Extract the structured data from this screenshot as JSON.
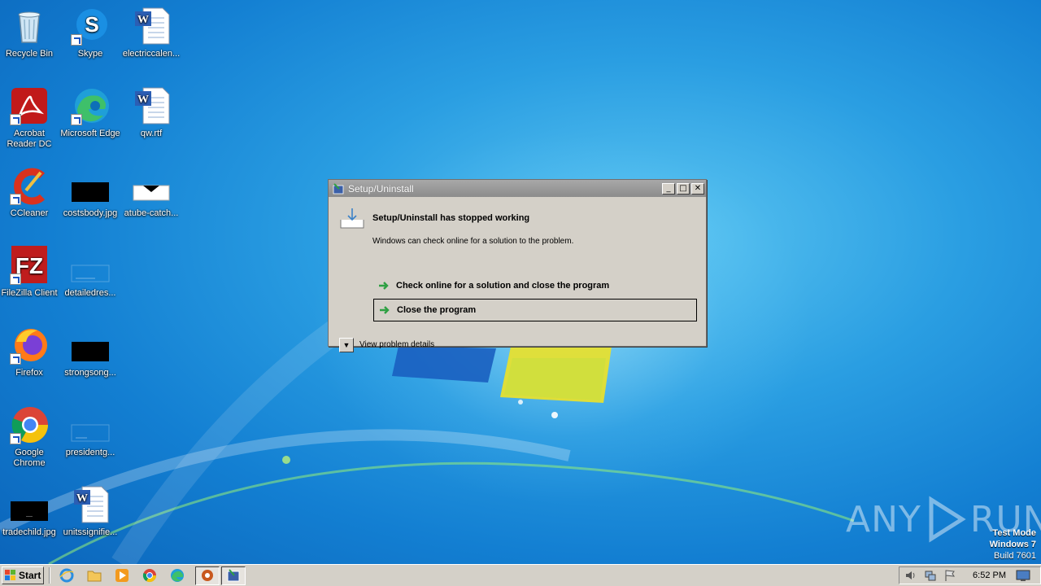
{
  "desktop": {
    "icons": [
      {
        "label": "Recycle Bin",
        "icon": "recycle-bin-icon"
      },
      {
        "label": "Skype",
        "icon": "skype-icon"
      },
      {
        "label": "electriccalen...",
        "icon": "word-document-icon"
      },
      {
        "label": "Acrobat Reader DC",
        "icon": "acrobat-icon"
      },
      {
        "label": "Microsoft Edge",
        "icon": "edge-icon"
      },
      {
        "label": "qw.rtf",
        "icon": "word-document-icon"
      },
      {
        "label": "CCleaner",
        "icon": "ccleaner-icon"
      },
      {
        "label": "costsbody.jpg",
        "icon": "image-file-icon"
      },
      {
        "label": "atube-catch...",
        "icon": "image-file-icon"
      },
      {
        "label": "FileZilla Client",
        "icon": "filezilla-icon"
      },
      {
        "label": "detailedres...",
        "icon": "image-file-icon"
      },
      {
        "label": "Firefox",
        "icon": "firefox-icon"
      },
      {
        "label": "strongsong...",
        "icon": "image-file-icon"
      },
      {
        "label": "Google Chrome",
        "icon": "chrome-icon"
      },
      {
        "label": "presidentg...",
        "icon": "image-file-icon"
      },
      {
        "label": "tradechild.jpg",
        "icon": "image-file-icon"
      },
      {
        "label": "unitssignifie...",
        "icon": "word-document-icon"
      }
    ]
  },
  "dialog": {
    "title": "Setup/Uninstall",
    "heading": "Setup/Uninstall has stopped working",
    "subtext": "Windows can check online for a solution to the problem.",
    "option_check_online": "Check online for a solution and close the program",
    "option_close": "Close the program",
    "details_label": "View problem details",
    "minimize_glyph": "_",
    "maximize_glyph": "□",
    "close_glyph": "✕",
    "details_glyph": "▼"
  },
  "watermark": {
    "left": "ANY",
    "right": "RUN"
  },
  "test_mode": {
    "line1": "Test Mode",
    "line2": "Windows 7",
    "line3": "Build 7601"
  },
  "taskbar": {
    "start_label": "Start",
    "clock": "6:52 PM"
  },
  "colors": {
    "desktop_blue": "#137fd2",
    "dialog_face": "#d4d0c8",
    "arrow_green": "#2ea043"
  }
}
